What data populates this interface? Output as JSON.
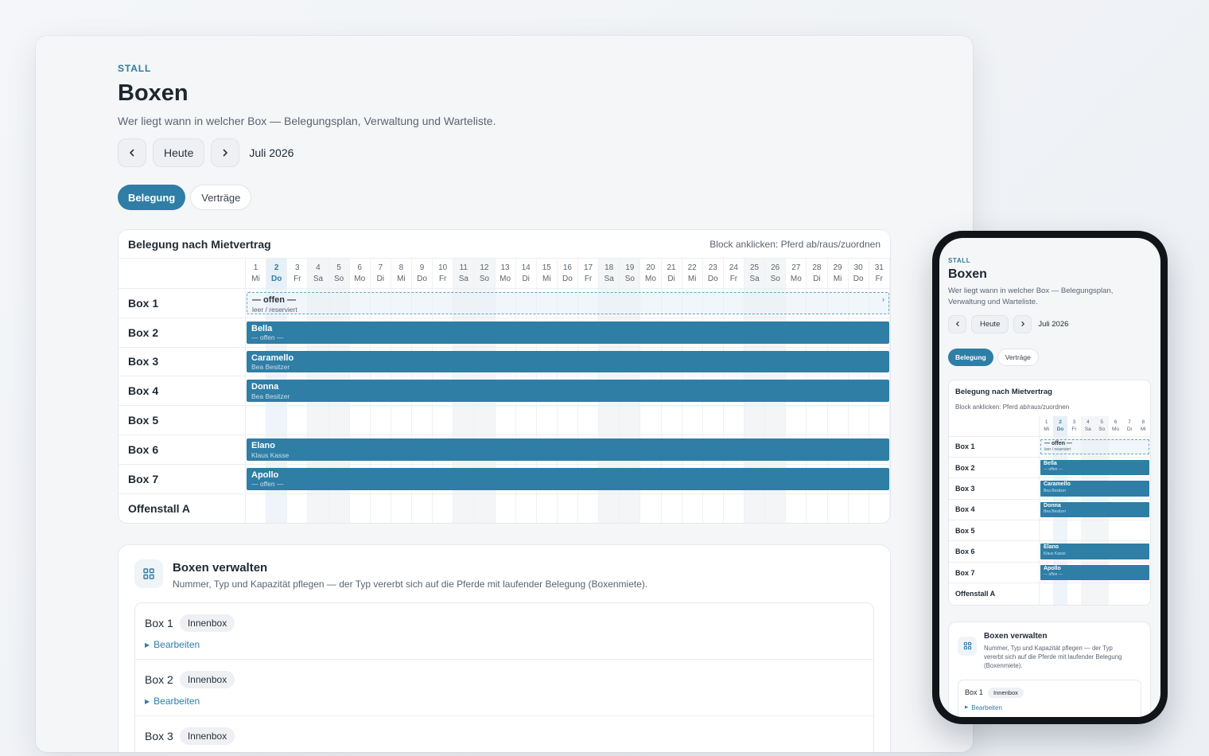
{
  "header": {
    "eyebrow": "STALL",
    "title": "Boxen",
    "subtitle": "Wer liegt wann in welcher Box — Belegungsplan, Verwaltung und Warteliste."
  },
  "nav": {
    "prev_icon": "chevron-left-icon",
    "today_label": "Heute",
    "next_icon": "chevron-right-icon",
    "month": "Juli 2026"
  },
  "tabs": [
    {
      "label": "Belegung",
      "active": true
    },
    {
      "label": "Verträge",
      "active": false
    }
  ],
  "occupancy": {
    "title": "Belegung nach Mietvertrag",
    "hint": "Block anklicken: Pferd ab/raus/zuordnen",
    "today_day": "2",
    "days": [
      {
        "n": "1",
        "w": "Mi"
      },
      {
        "n": "2",
        "w": "Do"
      },
      {
        "n": "3",
        "w": "Fr"
      },
      {
        "n": "4",
        "w": "Sa"
      },
      {
        "n": "5",
        "w": "So"
      },
      {
        "n": "6",
        "w": "Mo"
      },
      {
        "n": "7",
        "w": "Di"
      },
      {
        "n": "8",
        "w": "Mi"
      },
      {
        "n": "9",
        "w": "Do"
      },
      {
        "n": "10",
        "w": "Fr"
      },
      {
        "n": "11",
        "w": "Sa"
      },
      {
        "n": "12",
        "w": "So"
      },
      {
        "n": "13",
        "w": "Mo"
      },
      {
        "n": "14",
        "w": "Di"
      },
      {
        "n": "15",
        "w": "Mi"
      },
      {
        "n": "16",
        "w": "Do"
      },
      {
        "n": "17",
        "w": "Fr"
      },
      {
        "n": "18",
        "w": "Sa"
      },
      {
        "n": "19",
        "w": "So"
      },
      {
        "n": "20",
        "w": "Mo"
      },
      {
        "n": "21",
        "w": "Di"
      },
      {
        "n": "22",
        "w": "Mi"
      },
      {
        "n": "23",
        "w": "Do"
      },
      {
        "n": "24",
        "w": "Fr"
      },
      {
        "n": "25",
        "w": "Sa"
      },
      {
        "n": "26",
        "w": "So"
      },
      {
        "n": "27",
        "w": "Mo"
      },
      {
        "n": "28",
        "w": "Di"
      },
      {
        "n": "29",
        "w": "Mi"
      },
      {
        "n": "30",
        "w": "Do"
      },
      {
        "n": "31",
        "w": "Fr"
      }
    ],
    "rows": [
      {
        "box": "Box 1",
        "block": {
          "name": "— offen —",
          "sub": "leer / reserviert",
          "open": true,
          "chevron": "›"
        }
      },
      {
        "box": "Box 2",
        "block": {
          "name": "Bella",
          "sub": "— offen —",
          "open": false
        }
      },
      {
        "box": "Box 3",
        "block": {
          "name": "Caramello",
          "sub": "Bea Besitzer",
          "open": false
        }
      },
      {
        "box": "Box 4",
        "block": {
          "name": "Donna",
          "sub": "Bea Besitzer",
          "open": false
        }
      },
      {
        "box": "Box 5",
        "block": null
      },
      {
        "box": "Box 6",
        "block": {
          "name": "Elano",
          "sub": "Klaus Kasse",
          "open": false
        }
      },
      {
        "box": "Box 7",
        "block": {
          "name": "Apollo",
          "sub": "— offen —",
          "open": false
        }
      },
      {
        "box": "Offenstall A",
        "block": null
      }
    ]
  },
  "manage": {
    "icon": "grid-icon",
    "title": "Boxen verwalten",
    "description": "Nummer, Typ und Kapazität pflegen — der Typ vererbt sich auf die Pferde mit laufender Belegung (Boxenmiete).",
    "edit_label": "Bearbeiten",
    "boxes": [
      {
        "name": "Box 1",
        "type": "Innenbox"
      },
      {
        "name": "Box 2",
        "type": "Innenbox"
      },
      {
        "name": "Box 3",
        "type": "Innenbox"
      }
    ]
  },
  "phone": {
    "visible_days": 8,
    "subtitle_line1": "Wer liegt wann in welcher Box — Belegungsplan,",
    "subtitle_line2": "Verwaltung und Warteliste.",
    "manage_desc_lines": [
      "Nummer, Typ und Kapazität pflegen — der Typ",
      "vererbt sich auf die Pferde mit laufender Belegung",
      "(Boxenmiete)."
    ]
  },
  "colors": {
    "accent": "#2e7ea6",
    "eyebrow": "#2e7a9a",
    "weekend": "#f4f5f7"
  }
}
